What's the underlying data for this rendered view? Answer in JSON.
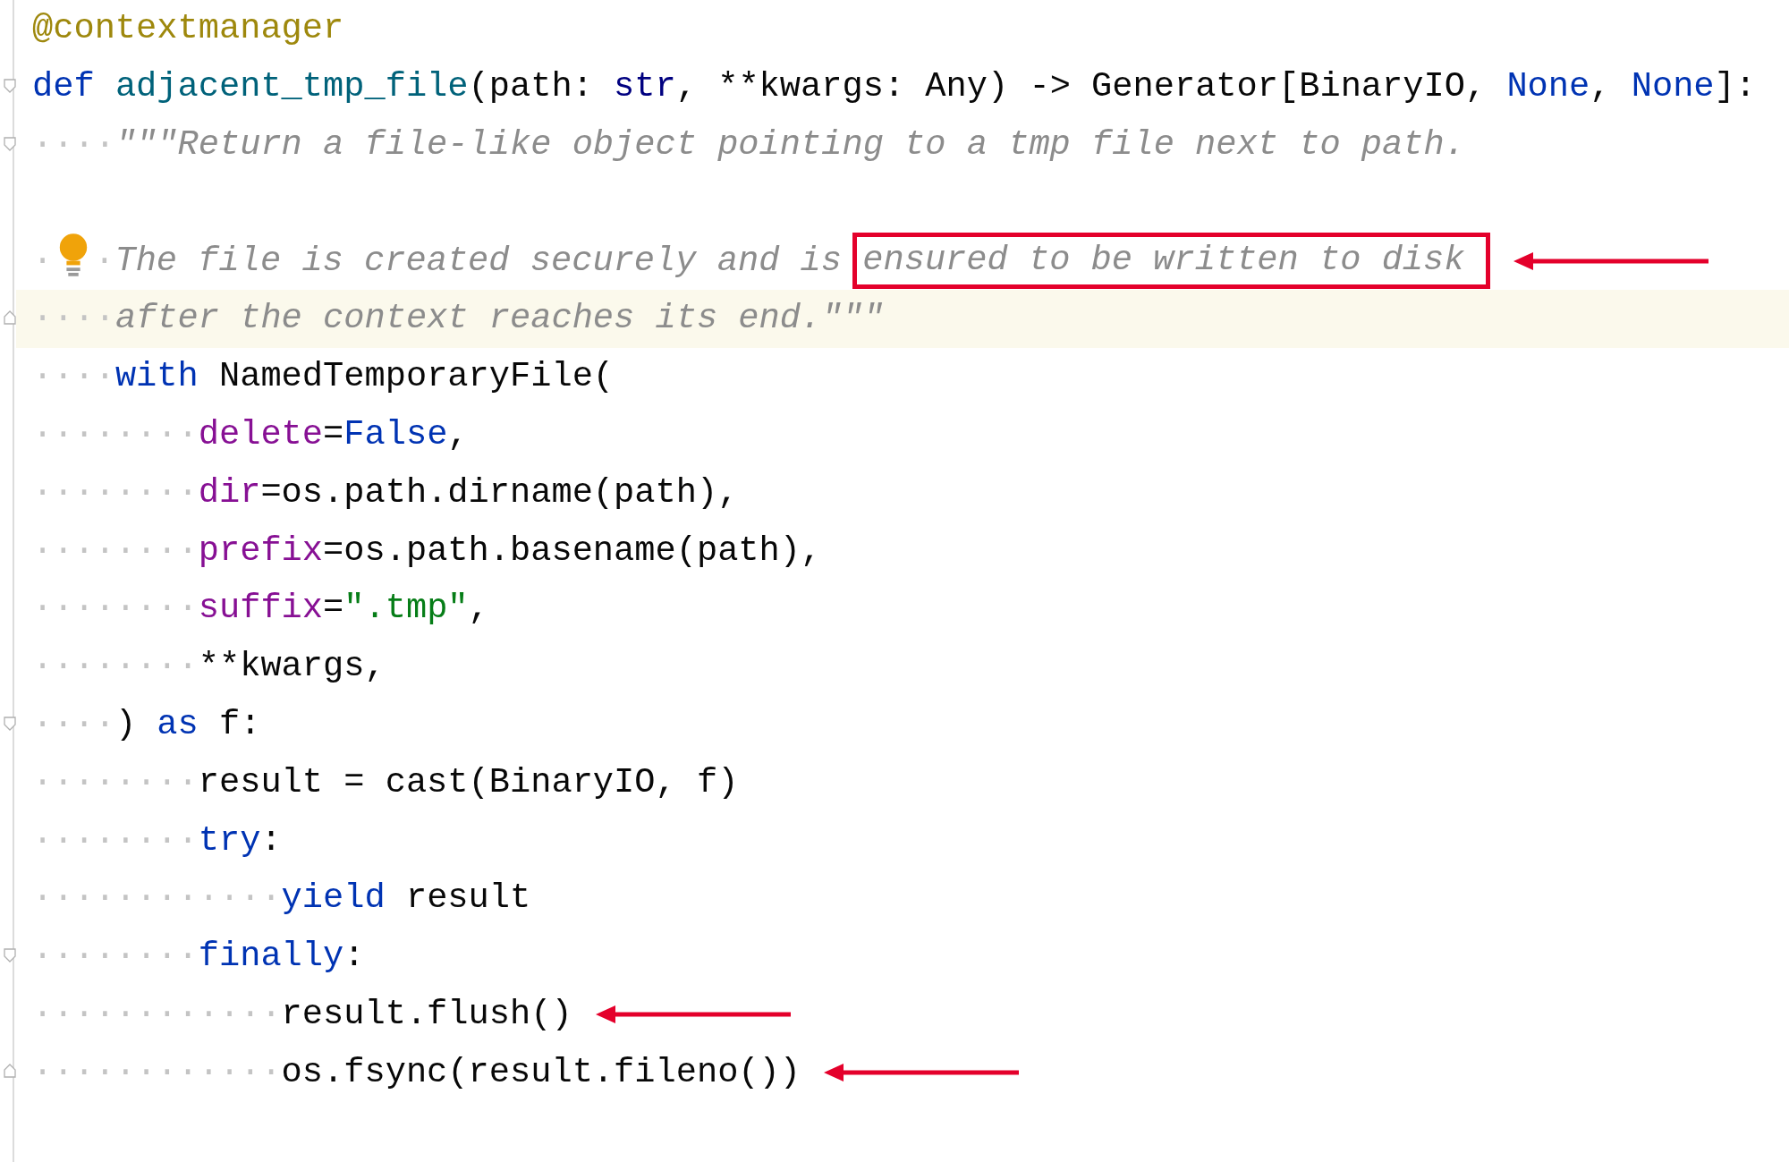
{
  "editor": {
    "lines": [
      {
        "fold_open": false,
        "fold_close": false,
        "highlighted": false,
        "arrow": false,
        "tokens": [
          {
            "kind": "decorator",
            "text": "@contextmanager"
          }
        ]
      },
      {
        "fold_open": true,
        "fold_close": false,
        "highlighted": false,
        "arrow": false,
        "tokens": [
          {
            "kind": "keyword",
            "text": "def "
          },
          {
            "kind": "func",
            "text": "adjacent_tmp_file"
          },
          {
            "kind": "plain",
            "text": "(path: "
          },
          {
            "kind": "builtin",
            "text": "str"
          },
          {
            "kind": "plain",
            "text": ", **kwargs: Any) -> Generator[BinaryIO, "
          },
          {
            "kind": "keyword",
            "text": "None"
          },
          {
            "kind": "plain",
            "text": ", "
          },
          {
            "kind": "keyword",
            "text": "None"
          },
          {
            "kind": "plain",
            "text": "]:"
          }
        ]
      },
      {
        "fold_open": true,
        "fold_close": false,
        "highlighted": false,
        "arrow": false,
        "tokens": [
          {
            "kind": "indent",
            "text": "····"
          },
          {
            "kind": "doc",
            "text": "\"\"\"Return a file-like object pointing to a tmp file next to path."
          }
        ]
      },
      {
        "fold_open": false,
        "fold_close": false,
        "highlighted": false,
        "arrow": false
      },
      {
        "fold_open": false,
        "fold_close": false,
        "highlighted": false,
        "arrow": true,
        "tokens": [
          {
            "kind": "indent",
            "text": "·"
          },
          {
            "kind": "bulb"
          },
          {
            "kind": "indent",
            "text": "·"
          },
          {
            "kind": "doc",
            "text": "The file is created securely and is "
          },
          {
            "kind": "doc",
            "boxed": true,
            "text": "ensured to be written to disk"
          }
        ]
      },
      {
        "fold_open": false,
        "fold_close": true,
        "highlighted": true,
        "arrow": false,
        "tokens": [
          {
            "kind": "indent",
            "text": "····"
          },
          {
            "kind": "doc",
            "text": "after the context reaches its end.\"\"\""
          }
        ]
      },
      {
        "fold_open": false,
        "fold_close": false,
        "highlighted": false,
        "arrow": false,
        "tokens": [
          {
            "kind": "indent",
            "text": "····"
          },
          {
            "kind": "keyword",
            "text": "with "
          },
          {
            "kind": "plain",
            "text": "NamedTemporaryFile("
          }
        ]
      },
      {
        "fold_open": false,
        "fold_close": false,
        "highlighted": false,
        "arrow": false,
        "tokens": [
          {
            "kind": "indent",
            "text": "········"
          },
          {
            "kind": "param",
            "text": "delete"
          },
          {
            "kind": "plain",
            "text": "="
          },
          {
            "kind": "keyword",
            "text": "False"
          },
          {
            "kind": "plain",
            "text": ","
          }
        ]
      },
      {
        "fold_open": false,
        "fold_close": false,
        "highlighted": false,
        "arrow": false,
        "tokens": [
          {
            "kind": "indent",
            "text": "········"
          },
          {
            "kind": "param",
            "text": "dir"
          },
          {
            "kind": "plain",
            "text": "=os.path.dirname(path),"
          }
        ]
      },
      {
        "fold_open": false,
        "fold_close": false,
        "highlighted": false,
        "arrow": false,
        "tokens": [
          {
            "kind": "indent",
            "text": "········"
          },
          {
            "kind": "param",
            "text": "prefix"
          },
          {
            "kind": "plain",
            "text": "=os.path.basename(path),"
          }
        ]
      },
      {
        "fold_open": false,
        "fold_close": false,
        "highlighted": false,
        "arrow": false,
        "tokens": [
          {
            "kind": "indent",
            "text": "········"
          },
          {
            "kind": "param",
            "text": "suffix"
          },
          {
            "kind": "plain",
            "text": "="
          },
          {
            "kind": "string",
            "text": "\".tmp\""
          },
          {
            "kind": "plain",
            "text": ","
          }
        ]
      },
      {
        "fold_open": false,
        "fold_close": false,
        "highlighted": false,
        "arrow": false,
        "tokens": [
          {
            "kind": "indent",
            "text": "········"
          },
          {
            "kind": "plain",
            "text": "**kwargs,"
          }
        ]
      },
      {
        "fold_open": true,
        "fold_close": false,
        "highlighted": false,
        "arrow": false,
        "tokens": [
          {
            "kind": "indent",
            "text": "····"
          },
          {
            "kind": "plain",
            "text": ") "
          },
          {
            "kind": "keyword",
            "text": "as "
          },
          {
            "kind": "plain",
            "text": "f:"
          }
        ]
      },
      {
        "fold_open": false,
        "fold_close": false,
        "highlighted": false,
        "arrow": false,
        "tokens": [
          {
            "kind": "indent",
            "text": "········"
          },
          {
            "kind": "plain",
            "text": "result = cast(BinaryIO, f)"
          }
        ]
      },
      {
        "fold_open": false,
        "fold_close": false,
        "highlighted": false,
        "arrow": false,
        "tokens": [
          {
            "kind": "indent",
            "text": "········"
          },
          {
            "kind": "keyword",
            "text": "try"
          },
          {
            "kind": "plain",
            "text": ":"
          }
        ]
      },
      {
        "fold_open": false,
        "fold_close": false,
        "highlighted": false,
        "arrow": false,
        "tokens": [
          {
            "kind": "indent",
            "text": "············"
          },
          {
            "kind": "keyword",
            "text": "yield "
          },
          {
            "kind": "plain",
            "text": "result"
          }
        ]
      },
      {
        "fold_open": true,
        "fold_close": false,
        "highlighted": false,
        "arrow": false,
        "tokens": [
          {
            "kind": "indent",
            "text": "········"
          },
          {
            "kind": "keyword",
            "text": "finally"
          },
          {
            "kind": "plain",
            "text": ":"
          }
        ]
      },
      {
        "fold_open": false,
        "fold_close": false,
        "highlighted": false,
        "arrow": true,
        "tokens": [
          {
            "kind": "indent",
            "text": "············"
          },
          {
            "kind": "plain",
            "text": "result.flush()"
          }
        ]
      },
      {
        "fold_open": false,
        "fold_close": true,
        "highlighted": false,
        "arrow": true,
        "tokens": [
          {
            "kind": "indent",
            "text": "············"
          },
          {
            "kind": "plain",
            "text": "os.fsync(result.fileno())"
          }
        ]
      }
    ]
  }
}
